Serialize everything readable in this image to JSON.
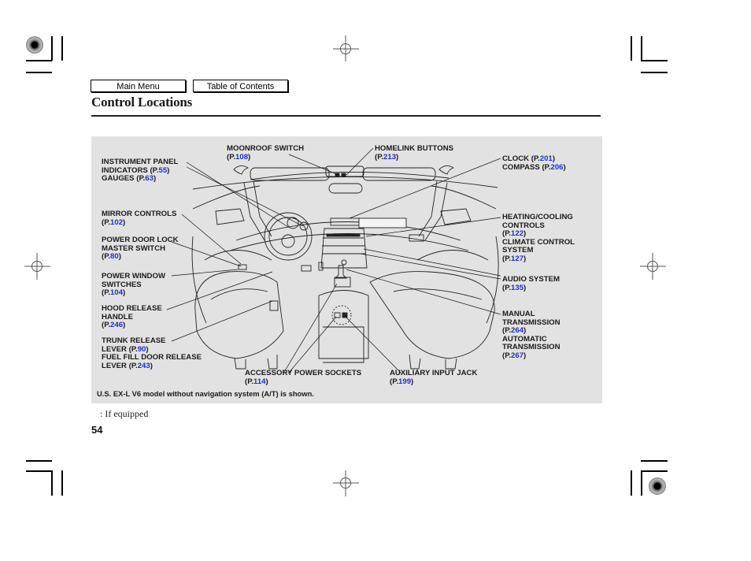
{
  "nav": {
    "main_menu": "Main Menu",
    "table_of_contents": "Table of Contents"
  },
  "page_title": "Control Locations",
  "labels": {
    "instrument_panel": {
      "lines": [
        "INSTRUMENT PANEL"
      ],
      "ind": "INDICATORS (P.",
      "ind_page": "55",
      "gauges": "GAUGES (P.",
      "gauges_page": "63"
    },
    "mirror_controls": {
      "title": "MIRROR CONTROLS",
      "page": "102"
    },
    "power_door_lock": {
      "line1": "POWER DOOR LOCK",
      "line2": "MASTER SWITCH",
      "page": "80"
    },
    "power_window": {
      "line1": "POWER WINDOW",
      "line2": "SWITCHES",
      "page": "104"
    },
    "hood_release": {
      "line1": "HOOD RELEASE",
      "line2": "HANDLE",
      "page": "246"
    },
    "trunk_release": {
      "line1": "TRUNK RELEASE",
      "line2": "LEVER (P.",
      "page": "90"
    },
    "fuel_fill": {
      "line1": "FUEL FILL DOOR RELEASE",
      "line2": "LEVER  (P.",
      "page": "243"
    },
    "moonroof": {
      "title": "MOONROOF SWITCH",
      "page": "108"
    },
    "homelink": {
      "title": "HOMELINK BUTTONS",
      "page": "213"
    },
    "clock": {
      "title": "CLOCK (P.",
      "page": "201"
    },
    "compass": {
      "title": "COMPASS   (P.",
      "page": "206"
    },
    "heating_cooling": {
      "line1": "HEATING/COOLING",
      "line2": "CONTROLS",
      "page": "122"
    },
    "climate_control": {
      "line1": "CLIMATE CONTROL",
      "line2": "SYSTEM",
      "page": "127"
    },
    "audio": {
      "title": "AUDIO SYSTEM",
      "page": "135"
    },
    "manual_trans": {
      "line1": "MANUAL",
      "line2": "TRANSMISSION",
      "page": "264"
    },
    "auto_trans": {
      "line1": "AUTOMATIC",
      "line2": "TRANSMISSION",
      "page": "267"
    },
    "accessory_power": {
      "title": "ACCESSORY POWER SOCKETS",
      "page": "114"
    },
    "aux_input": {
      "title": "AUXILIARY INPUT JACK",
      "page": "199"
    },
    "page_prefix": "(P.",
    "page_suffix": ")"
  },
  "model_note": "U.S. EX-L V6 model without navigation system (A/T) is shown.",
  "footnote": ":  If equipped",
  "page_number": "54",
  "colors": {
    "page_ref": "#1f2bd6",
    "panel_bg": "#e2e2e2"
  }
}
